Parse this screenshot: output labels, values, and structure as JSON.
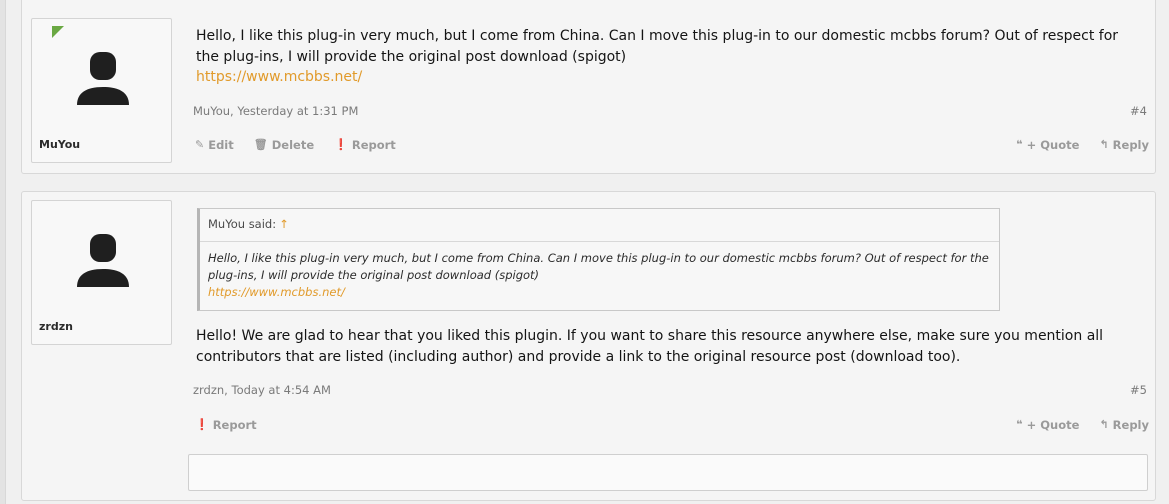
{
  "posts": [
    {
      "username": "MuYou",
      "message": "Hello, I like this plug-in very much, but I come from China. Can I move this plug-in to our domestic mcbbs forum? Out of respect for the plug-ins, I will provide the original post download (spigot)",
      "link": "https://www.mcbbs.net/",
      "meta": "MuYou, Yesterday at 1:31 PM",
      "number": "#4",
      "actions": [
        "Edit",
        "Delete",
        "Report"
      ],
      "actions_right": [
        "+ Quote",
        "Reply"
      ]
    },
    {
      "username": "zrdzn",
      "quote": {
        "author": "MuYou said:",
        "up_arrow": "↑",
        "text": "Hello, I like this plug-in very much, but I come from China. Can I move this plug-in to our domestic mcbbs forum? Out of respect for the plug-ins, I will provide the original post download (spigot)",
        "link": "https://www.mcbbs.net/"
      },
      "message": "Hello! We are glad to hear that you liked this plugin. If you want to share this resource anywhere else, make sure you mention all contributors that are listed (including author) and provide a link to the original resource post (download too).",
      "meta": "zrdzn, Today at 4:54 AM",
      "number": "#5",
      "actions": [
        "Report"
      ],
      "actions_right": [
        "+ Quote",
        "Reply"
      ]
    }
  ],
  "icons": {
    "avatar": "default-avatar-silhouette-icon",
    "edit": "pencil-icon",
    "delete": "trash-icon",
    "report": "alert-circle-icon",
    "quote": "quote-marks-icon",
    "reply": "reply-arrow-icon"
  },
  "colors": {
    "link": "#e19a2a",
    "online": "#6aa843",
    "muted": "#9a9a9a"
  }
}
